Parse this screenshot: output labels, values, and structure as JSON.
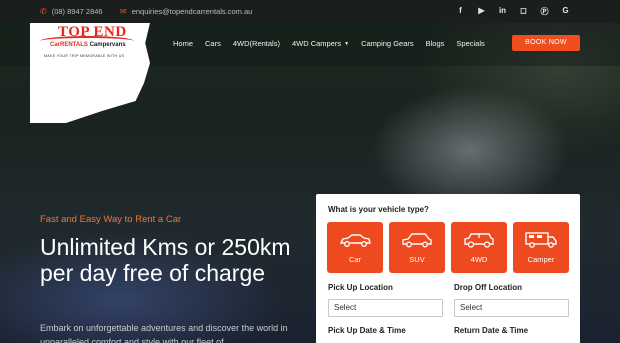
{
  "topbar": {
    "phone": "(08) 8947 2846",
    "email": "enquiries@topendcarrentals.com.au",
    "socials": [
      "f",
      "youtube-icon",
      "in",
      "instagram-icon",
      "pinterest-icon",
      "G"
    ]
  },
  "logo": {
    "brand": "TOP END",
    "sub_left": "CarRENTALS",
    "sub_right": "Campervans",
    "tagline": "MAKE YOUR TRIP MEMORABLE WITH US"
  },
  "nav": {
    "items": [
      "Home",
      "Cars",
      "4WD(Rentals)",
      "4WD Campers",
      "Camping Gears",
      "Blogs",
      "Specials"
    ],
    "book_label": "BOOK NOW"
  },
  "hero": {
    "tagline": "Fast and Easy Way to Rent a Car",
    "title": "Unlimited Kms or 250km per day free of charge",
    "description": "Embark on unforgettable adventures and discover the world in unparalleled comfort and style with our fleet of"
  },
  "booking": {
    "question": "What is your vehicle type?",
    "vehicles": [
      "Car",
      "SUV",
      "4WD",
      "Camper"
    ],
    "pickup_location_label": "Pick Up Location",
    "dropoff_location_label": "Drop Off Location",
    "pickup_select": "Select",
    "dropoff_select": "Select",
    "pickup_datetime_label": "Pick Up Date & Time",
    "return_datetime_label": "Return Date & Time"
  },
  "colors": {
    "accent": "#f04e1f",
    "tagline": "#f0743d",
    "topbar_bg": "#1a1f1d"
  }
}
